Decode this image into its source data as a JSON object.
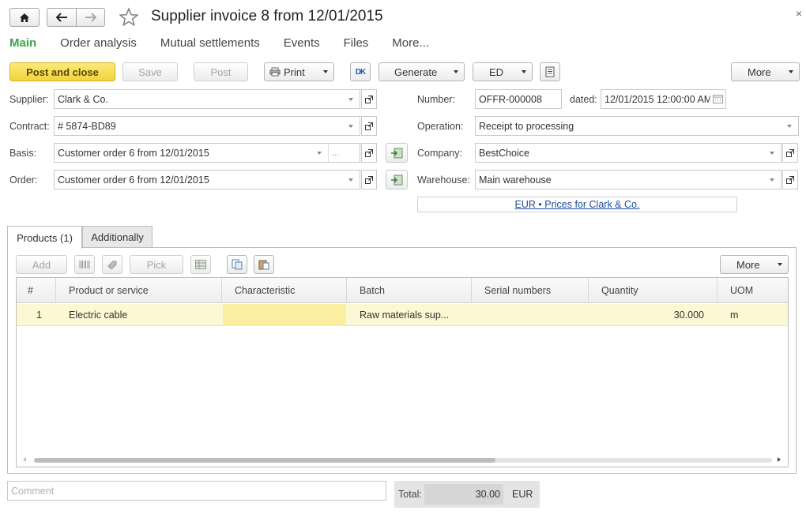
{
  "header": {
    "title": "Supplier invoice 8 from 12/01/2015",
    "close": "×"
  },
  "section_tabs": [
    "Main",
    "Order analysis",
    "Mutual settlements",
    "Events",
    "Files",
    "More..."
  ],
  "toolbar": {
    "post_and_close": "Post and close",
    "save": "Save",
    "post": "Post",
    "print": "Print",
    "dk": "DK",
    "generate": "Generate",
    "ed": "ED",
    "more": "More"
  },
  "form": {
    "supplier_label": "Supplier:",
    "supplier": "Clark & Co.",
    "contract_label": "Contract:",
    "contract": "# 5874-BD89",
    "basis_label": "Basis:",
    "basis": "Customer order 6 from 12/01/2015",
    "order_label": "Order:",
    "order": "Customer order 6 from 12/01/2015",
    "number_label": "Number:",
    "number": "OFFR-000008",
    "dated_label": "dated:",
    "dated": "12/01/2015 12:00:00 AM",
    "operation_label": "Operation:",
    "operation": "Receipt to processing",
    "company_label": "Company:",
    "company": "BestChoice",
    "warehouse_label": "Warehouse:",
    "warehouse": "Main warehouse",
    "price_link": "EUR • Prices for Clark & Co."
  },
  "panel_tabs": [
    "Products (1)",
    "Additionally"
  ],
  "table_toolbar": {
    "add": "Add",
    "pick": "Pick",
    "more": "More"
  },
  "table": {
    "columns": [
      "#",
      "Product or service",
      "Characteristic",
      "Batch",
      "Serial numbers",
      "Quantity",
      "UOM"
    ],
    "rows": [
      {
        "num": "1",
        "product": "Electric cable",
        "characteristic": "",
        "batch": "Raw materials sup...",
        "serial": "",
        "quantity": "30.000",
        "uom": "m"
      }
    ]
  },
  "footer": {
    "comment_placeholder": "Comment",
    "total_label": "Total:",
    "total_value": "30.00",
    "currency": "EUR"
  }
}
